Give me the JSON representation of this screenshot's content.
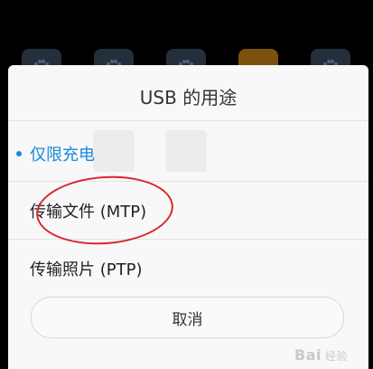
{
  "dialog": {
    "title": "USB 的用途",
    "options": [
      {
        "label": "仅限充电",
        "selected": true
      },
      {
        "label": "传输文件 (MTP)",
        "selected": false
      },
      {
        "label": "传输照片 (PTP)",
        "selected": false
      }
    ],
    "cancel_label": "取消"
  },
  "watermark": {
    "brand": "Bai",
    "suffix": "经验"
  },
  "colors": {
    "accent": "#1a88d8",
    "annotation": "#d9262b",
    "sheet_bg": "#f8f8f8"
  },
  "icons": [
    "paw-icon"
  ]
}
